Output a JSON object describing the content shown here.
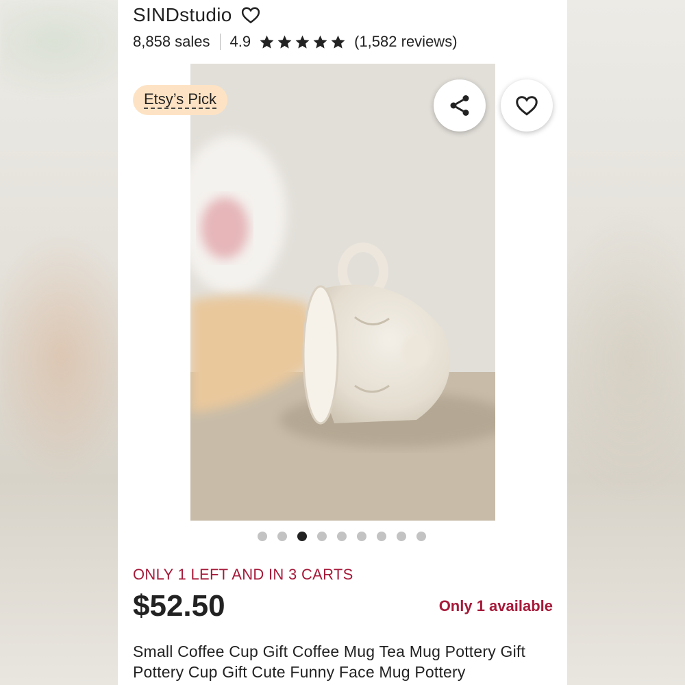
{
  "shop": {
    "name": "SINDstudio",
    "favorite_icon": "heart-outline-icon"
  },
  "stats": {
    "sales": "8,858 sales",
    "rating": "4.9",
    "stars_filled": 5,
    "reviews": "(1,582 reviews)"
  },
  "badge": {
    "label": "Etsy’s Pick"
  },
  "image_actions": {
    "share_icon": "share-icon",
    "favorite_icon": "heart-outline-icon"
  },
  "gallery": {
    "total_images": 9,
    "active_index": 2
  },
  "listing": {
    "scarcity": "ONLY 1 LEFT AND IN 3 CARTS",
    "price": "$52.50",
    "availability": "Only 1 available",
    "title": "Small Coffee Cup Gift Coffee Mug Tea Mug Pottery Gift Pottery Cup Gift Cute Funny Face Mug Pottery"
  },
  "colors": {
    "accent_red": "#a61a3a",
    "badge_bg": "#fde3c4",
    "text": "#222222"
  }
}
